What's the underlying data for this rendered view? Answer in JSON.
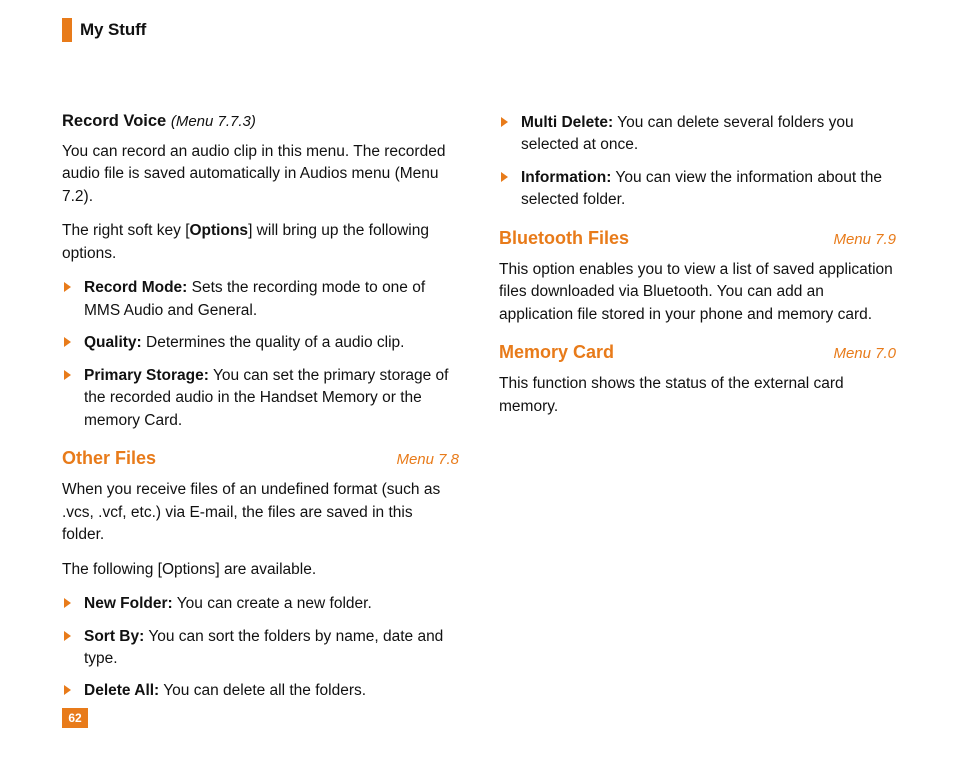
{
  "header": {
    "title": "My Stuff"
  },
  "pageNumber": "62",
  "left": {
    "recordVoice": {
      "title": "Record Voice",
      "ref": "(Menu 7.7.3)",
      "para1": "You can record an audio clip in this menu. The recorded audio file is saved automatically in Audios menu (Menu 7.2).",
      "para2_a": "The right soft key [",
      "para2_opt": "Options",
      "para2_b": "] will bring up the following options.",
      "bullets": [
        {
          "label": "Record Mode:",
          "text": " Sets the recording mode to one of MMS Audio and General."
        },
        {
          "label": "Quality:",
          "text": " Determines the quality of a audio clip."
        },
        {
          "label": "Primary Storage:",
          "text": " You can set the primary storage of the recorded audio in the Handset Memory or the memory Card."
        }
      ]
    },
    "otherFiles": {
      "title": "Other Files",
      "ref": "Menu 7.8",
      "para1": "When you receive files of an undefined format (such as .vcs, .vcf, etc.) via E-mail, the files are saved in this folder.",
      "para2": "The following [Options] are available.",
      "bullets": [
        {
          "label": "New Folder:",
          "text": " You can create a new folder."
        },
        {
          "label": "Sort By:",
          "text": " You can sort the folders by name, date and type."
        },
        {
          "label": "Delete All:",
          "text": " You can delete all the folders."
        }
      ]
    }
  },
  "right": {
    "topBullets": [
      {
        "label": "Multi Delete:",
        "text": " You can delete several folders you selected at once."
      },
      {
        "label": "Information:",
        "text": " You can view the information about the selected folder."
      }
    ],
    "bluetooth": {
      "title": "Bluetooth Files",
      "ref": "Menu 7.9",
      "para": "This option enables you to view a list of saved application files downloaded via Bluetooth. You can add an application file stored in your phone and memory card."
    },
    "memoryCard": {
      "title": "Memory Card",
      "ref": "Menu 7.0",
      "para": "This function shows the status of the external card memory."
    }
  }
}
